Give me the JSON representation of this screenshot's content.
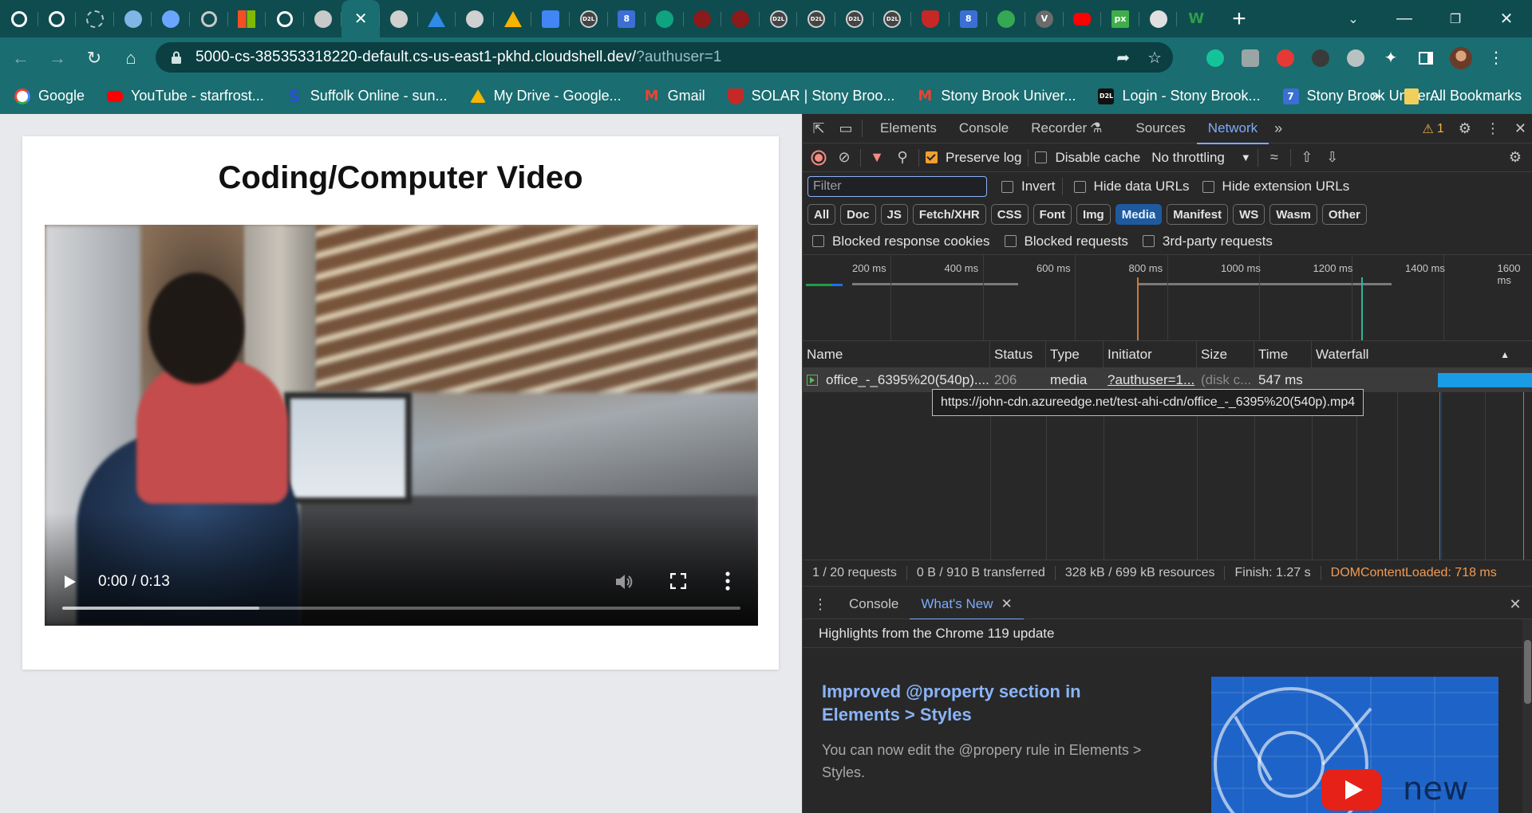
{
  "browser": {
    "tabs": [
      {
        "icon": "github-icon",
        "color": "#ffffff"
      },
      {
        "icon": "github-icon",
        "color": "#ffffff"
      },
      {
        "icon": "loading-icon",
        "color": "#b0c9c9"
      },
      {
        "icon": "swirl-icon",
        "color": "#7fb6e6"
      },
      {
        "icon": "cloud-icon",
        "color": "#6aa6ff"
      },
      {
        "icon": "github-icon",
        "color": "#c9c9c9"
      },
      {
        "icon": "microsoft-icon",
        "color": "#f25022"
      },
      {
        "icon": "github-icon",
        "color": "#ffffff"
      },
      {
        "icon": "terminal-icon",
        "color": "#c9c9c9"
      },
      {
        "icon": "close-icon",
        "color": "#ffffff",
        "active": true
      },
      {
        "icon": "globe-icon",
        "color": "#d0d0d0"
      },
      {
        "icon": "azure-icon",
        "color": "#2f8be6"
      },
      {
        "icon": "globe-icon",
        "color": "#d0d0d0"
      },
      {
        "icon": "google-drive-icon",
        "color": "#f4b400"
      },
      {
        "icon": "google-docs-icon",
        "color": "#4285f4"
      },
      {
        "icon": "d2l-icon",
        "color": "#444444"
      },
      {
        "icon": "calendar-icon",
        "color": "#3b6fd6"
      },
      {
        "icon": "openai-icon",
        "color": "#10a37f"
      },
      {
        "icon": "stony-brook-icon",
        "color": "#8b1a1a"
      },
      {
        "icon": "stony-brook-icon",
        "color": "#8b1a1a"
      },
      {
        "icon": "d2l-icon",
        "color": "#444444"
      },
      {
        "icon": "d2l-icon",
        "color": "#444444"
      },
      {
        "icon": "d2l-icon",
        "color": "#444444"
      },
      {
        "icon": "d2l-icon",
        "color": "#444444"
      },
      {
        "icon": "shield-icon",
        "color": "#c62828"
      },
      {
        "icon": "calendar-icon",
        "color": "#3b6fd6"
      },
      {
        "icon": "chrome-icon",
        "color": "#34a853"
      },
      {
        "icon": "v-icon",
        "color": "#6b6b6b"
      },
      {
        "icon": "youtube-icon",
        "color": "#ff0000"
      },
      {
        "icon": "px-icon",
        "color": "#3fae49"
      },
      {
        "icon": "chrome-icon",
        "color": "#e0e0e0"
      },
      {
        "icon": "w-icon",
        "color": "#2e9e4b"
      }
    ],
    "url_host": "5000-cs-385353318220-default.cs-us-east1-pkhd.cloudshell.dev/",
    "url_query": "?authuser=1",
    "bookmarks": [
      {
        "label": "Google",
        "icon": "google-icon",
        "color": "#ffffff"
      },
      {
        "label": "YouTube - starfrost...",
        "icon": "youtube-icon",
        "color": "#ff0000"
      },
      {
        "label": "Suffolk Online - sun...",
        "icon": "suffolk-icon",
        "color": "#1e3a8a"
      },
      {
        "label": "My Drive - Google...",
        "icon": "google-drive-icon",
        "color": "#f4b400"
      },
      {
        "label": "Gmail",
        "icon": "gmail-icon",
        "color": "#ea4335"
      },
      {
        "label": "SOLAR | Stony Broo...",
        "icon": "shield-icon",
        "color": "#c62828"
      },
      {
        "label": "Stony Brook Univer...",
        "icon": "gmail-icon",
        "color": "#ea4335"
      },
      {
        "label": "Login - Stony Brook...",
        "icon": "d2l-icon",
        "color": "#111111"
      },
      {
        "label": "Stony Brook Univer...",
        "icon": "calendar-icon",
        "color": "#3b6fd6"
      }
    ],
    "bookmarks_more": "»",
    "all_bookmarks": "All Bookmarks"
  },
  "page": {
    "title": "Coding/Computer Video",
    "video": {
      "time": "0:00 / 0:13",
      "progress": 0.29
    }
  },
  "devtools": {
    "tabs": [
      "Elements",
      "Console",
      "Recorder",
      "Sources",
      "Network"
    ],
    "active_tab": "Network",
    "warning_count": "1",
    "preserve_log": "Preserve log",
    "disable_cache": "Disable cache",
    "throttling": "No throttling",
    "filter_placeholder": "Filter",
    "invert": "Invert",
    "hide_data_urls": "Hide data URLs",
    "hide_extension_urls": "Hide extension URLs",
    "type_filters": [
      "All",
      "Doc",
      "JS",
      "Fetch/XHR",
      "CSS",
      "Font",
      "Img",
      "Media",
      "Manifest",
      "WS",
      "Wasm",
      "Other"
    ],
    "active_type": "Media",
    "blocked_response_cookies": "Blocked response cookies",
    "blocked_requests": "Blocked requests",
    "third_party_requests": "3rd-party requests",
    "overview_ticks": [
      "200 ms",
      "400 ms",
      "600 ms",
      "800 ms",
      "1000 ms",
      "1200 ms",
      "1400 ms",
      "1600 ms"
    ],
    "columns": [
      "Name",
      "Status",
      "Type",
      "Initiator",
      "Size",
      "Time",
      "Waterfall"
    ],
    "request": {
      "name": "office_-_6395%20(540p)....",
      "status": "206",
      "type": "media",
      "initiator": "?authuser=1...",
      "size": "(disk c...",
      "time": "547 ms"
    },
    "tooltip": "https://john-cdn.azureedge.net/test-ahi-cdn/office_-_6395%20(540p).mp4",
    "summary": {
      "requests": "1 / 20 requests",
      "transferred": "0 B / 910 B transferred",
      "resources": "328 kB / 699 kB resources",
      "finish": "Finish: 1.27 s",
      "dom_loaded": "DOMContentLoaded: 718 ms"
    },
    "drawer": {
      "tabs": [
        "Console",
        "What's New"
      ],
      "active_tab": "What's New",
      "highlights": "Highlights from the Chrome 119 update",
      "article_title": "Improved @property section in Elements > Styles",
      "article_body": "You can now edit the @propery rule in Elements > Styles.",
      "image_caption": "new"
    }
  }
}
